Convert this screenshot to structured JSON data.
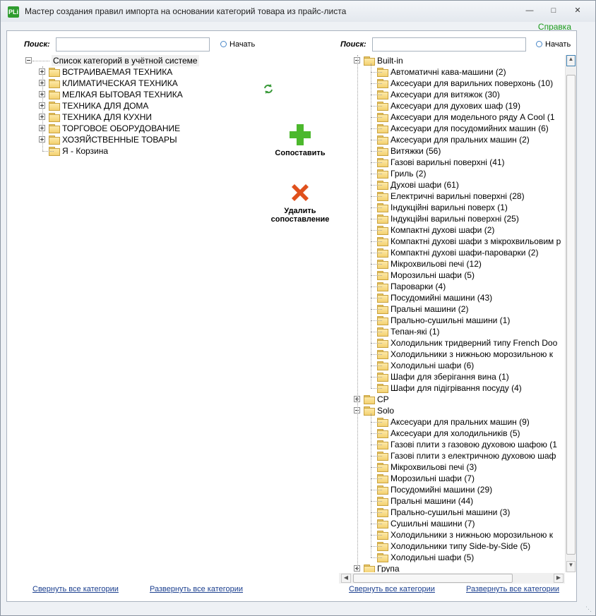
{
  "window": {
    "icon_text": "PLi",
    "title": "Мастер создания правил импорта на основании категорий товара из прайс-листа",
    "help_link": "Справка"
  },
  "left": {
    "search_label": "Поиск:",
    "search_value": "",
    "search_button": "Начать",
    "root": "Список категорий в учётной системе",
    "items": [
      "ВСТРАИВАЕМАЯ ТЕХНИКА",
      "КЛИМАТИЧЕСКАЯ ТЕХНИКА",
      "МЕЛКАЯ БЫТОВАЯ ТЕХНИКА",
      "ТЕХНИКА ДЛЯ ДОМА",
      "ТЕХНИКА ДЛЯ КУХНИ",
      "ТОРГОВОЕ ОБОРУДОВАНИЕ",
      "ХОЗЯЙСТВЕННЫЕ ТОВАРЫ",
      "Я - Корзина"
    ],
    "collapse_all": "Свернуть все категории",
    "expand_all": "Развернуть все категории"
  },
  "middle": {
    "match_label": "Сопоставить",
    "delete_label": "Удалить сопоставление"
  },
  "right": {
    "search_label": "Поиск:",
    "search_value": "",
    "search_button": "Начать",
    "groups": [
      {
        "name": "Built-in",
        "expanded": true,
        "children": [
          "Автоматичні кава-машини (2)",
          "Аксесуари для варильних поверхонь (10)",
          "Аксесуари для витяжок (30)",
          "Аксесуари для духових шаф (19)",
          "Аксесуари для модельного ряду A Cool (1",
          "Аксесуари для посудомийних машин (6)",
          "Аксесуари для пральних машин (2)",
          "Витяжки (56)",
          "Газові варильні поверхні (41)",
          "Гриль (2)",
          "Духові шафи (61)",
          "Електричні варильні поверхні (28)",
          "Індукційні варильні поверх (1)",
          "Індукційні варильні поверхні (25)",
          "Компактні духові шафи (2)",
          "Компактні духові шафи з мікрохвильовим р",
          "Компактні духові шафи-пароварки (2)",
          "Мікрохвильові печі (12)",
          "Морозильні шафи (5)",
          "Пароварки (4)",
          "Посудомийні машини (43)",
          "Пральні машини (2)",
          "Прально-сушильні машини (1)",
          "Тепан-які (1)",
          "Холодильник тридверний типу French Doo",
          "Холодильники з нижньою морозильною к",
          "Холодильні шафи (6)",
          "Шафи для зберігання вина (1)",
          "Шафи для підігрівання посуду (4)"
        ]
      },
      {
        "name": "CP",
        "expanded": false,
        "children": []
      },
      {
        "name": "Solo",
        "expanded": true,
        "children": [
          "Аксесуари для пральних машин (9)",
          "Аксесуари для холодильників (5)",
          "Газові плити з газовою духовою шафою (1",
          "Газові плити з електричною духовою шаф",
          "Мікрохвильові печі (3)",
          "Морозильні шафи (7)",
          "Посудомийні машини (29)",
          "Пральні машини (44)",
          "Прально-сушильні машини (3)",
          "Сушильні машини (7)",
          "Холодильники з нижньою морозильною к",
          "Холодильники типу Side-by-Side (5)",
          "Холодильні шафи (5)"
        ]
      },
      {
        "name": "Група",
        "expanded": false,
        "children": []
      }
    ],
    "collapse_all": "Свернуть все категории",
    "expand_all": "Развернуть все категории"
  },
  "colors": {
    "accent_green": "#1a9a1a",
    "link_blue": "#1b3f8f",
    "folder": "#f3d171"
  }
}
